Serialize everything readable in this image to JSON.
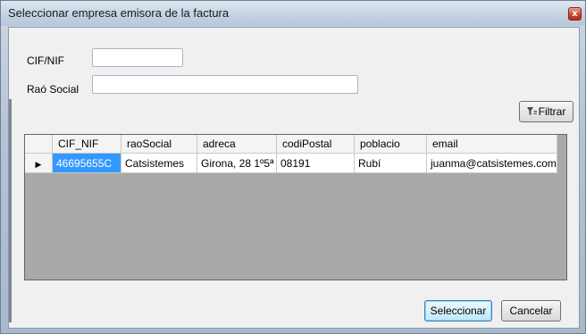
{
  "window": {
    "title": "Seleccionar empresa emisora de la factura",
    "close_glyph": "x"
  },
  "form": {
    "cif_label": "CIF/NIF",
    "cif_value": "",
    "rao_label": "Raó Social",
    "rao_value": "",
    "filter_button": "Filtrar",
    "filter_icon": "filter-icon"
  },
  "grid": {
    "columns": [
      "CIF_NIF",
      "raoSocial",
      "adreca",
      "codiPostal",
      "poblacio",
      "email"
    ],
    "rows": [
      {
        "indicator": "▶",
        "cells": [
          "46695655C",
          "Catsistemes",
          "Girona, 28 1º5ª",
          "08191",
          "Rubí",
          "juanma@catsistemes.com"
        ]
      }
    ]
  },
  "footer": {
    "select_button": "Seleccionar",
    "cancel_button": "Cancelar"
  },
  "colors": {
    "selection": "#3399ff",
    "grid_background": "#a9a9a9"
  }
}
